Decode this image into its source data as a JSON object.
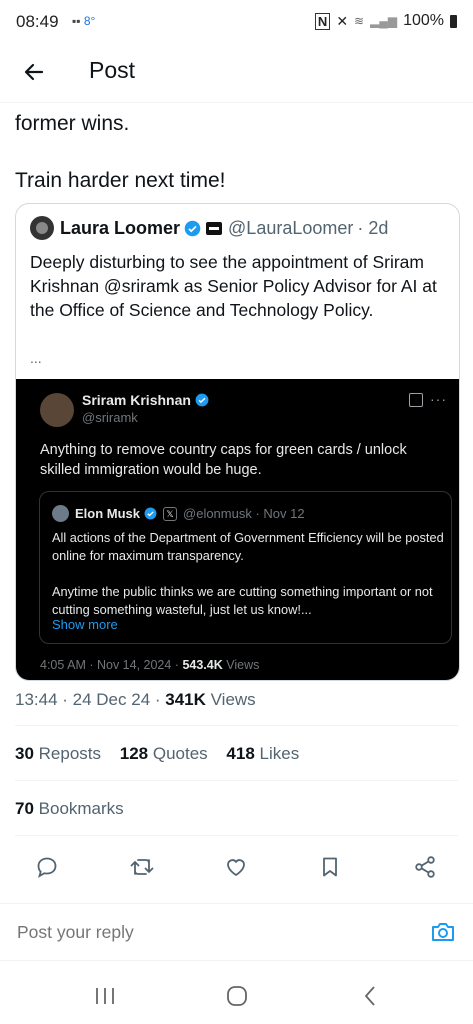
{
  "status_bar": {
    "time": "08:49",
    "temp": "8°",
    "battery": "100%"
  },
  "header": {
    "title": "Post"
  },
  "post": {
    "text_line1": "former wins.",
    "text_line2": "Train harder next time!"
  },
  "quote": {
    "name": "Laura Loomer",
    "handle": "@LauraLoomer",
    "time": "· 2d",
    "text": "Deeply disturbing to see the appointment of Sriram Krishnan @sriramk as Senior Policy Advisor for AI at the Office of Science and Technology Policy.",
    "ellipsis": "...",
    "embedded": {
      "name": "Sriram Krishnan",
      "handle": "@sriramk",
      "text": "Anything to remove country caps for green cards / unlock skilled immigration would be huge.",
      "inner": {
        "name": "Elon Musk",
        "handle": "@elonmusk · Nov 12",
        "text": "All actions of the Department of Government Efficiency will be posted online for maximum transparency.\n\nAnytime the public thinks we are cutting something important or not cutting something wasteful, just let us know!...",
        "show_more": "Show more"
      },
      "timestamp": "4:05 AM · Nov 14, 2024 · ",
      "views_count": "543.4K",
      "views_label": " Views"
    }
  },
  "meta": {
    "time": "13:44 · 24 Dec 24 · ",
    "views_count": "341K",
    "views_label": " Views"
  },
  "stats": {
    "reposts_count": "30",
    "reposts_label": " Reposts",
    "quotes_count": "128",
    "quotes_label": " Quotes",
    "likes_count": "418",
    "likes_label": " Likes",
    "bookmarks_count": "70",
    "bookmarks_label": " Bookmarks"
  },
  "reply": {
    "placeholder": "Post your reply"
  },
  "colors": {
    "accent": "#1d9bf0",
    "text": "#0f1419",
    "muted": "#536471"
  }
}
